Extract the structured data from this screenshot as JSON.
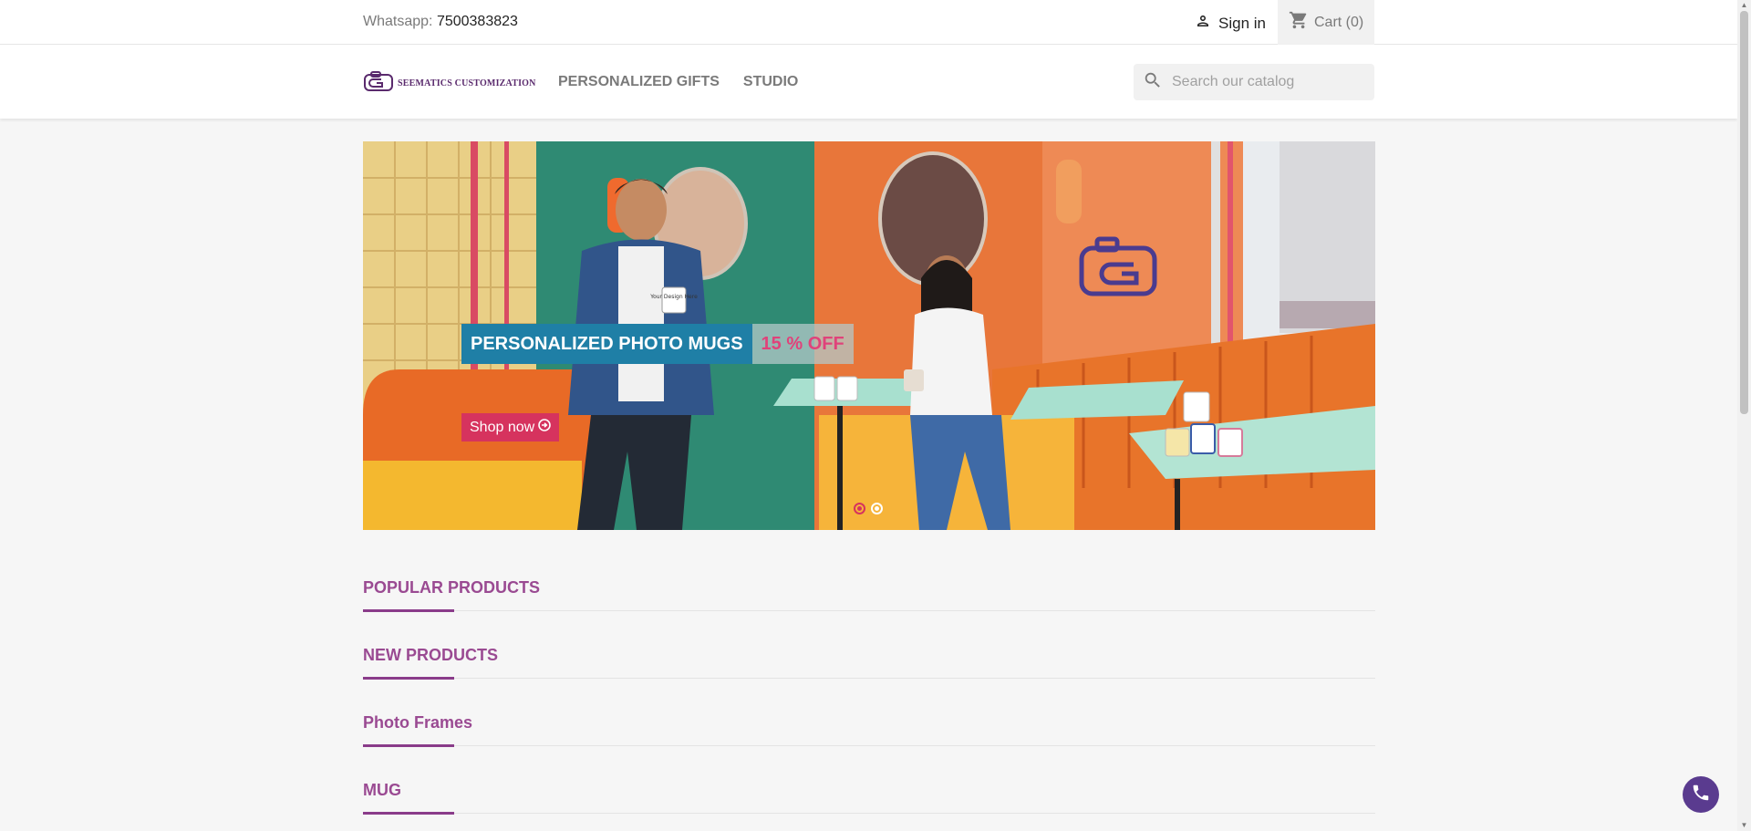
{
  "topbar": {
    "contact_label": "Whatsapp:",
    "contact_number": "7500383823",
    "signin_label": "Sign in",
    "cart_label": "Cart (0)"
  },
  "header": {
    "logo_text": "SEEMATICS CUSTOMIZATION",
    "nav": [
      "PERSONALIZED GIFTS",
      "STUDIO"
    ],
    "search_placeholder": "Search our catalog"
  },
  "banner": {
    "title": "PERSONALIZED PHOTO MUGS",
    "discount": "15 % OFF",
    "cta": "Shop now",
    "mug_text": "Your Design Here",
    "slide_count": 2,
    "active_slide": 1
  },
  "sections": [
    "POPULAR PRODUCTS",
    "NEW PRODUCTS",
    "Photo Frames",
    "MUG"
  ],
  "colors": {
    "brand_purple": "#5a2a6d",
    "section_title": "#9a4a92",
    "accent_pink": "#d6335e",
    "banner_blue": "#1f7fa6",
    "call_button": "#5a3b8f"
  },
  "icons": {
    "user": "user-icon",
    "cart": "cart-icon",
    "search": "search-icon",
    "logo": "camera-logo-icon",
    "cta": "arrow-circle-right-icon",
    "call": "phone-icon"
  }
}
